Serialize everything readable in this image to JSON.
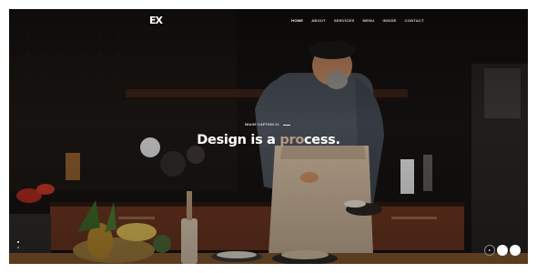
{
  "brand": {
    "logo_text": "EX"
  },
  "nav": {
    "items": [
      "HOME",
      "ABOUT",
      "SERVICES",
      "MENU",
      "INSIDE",
      "CONTACT"
    ],
    "active_index": 0
  },
  "hero": {
    "caption": "IMAGE CAPTION #1",
    "headline_part1": "Design is a ",
    "headline_dim": "pro",
    "headline_part2": "cess."
  },
  "slider": {
    "slide_count": 2,
    "active_slide": 1
  },
  "colors": {
    "background": "#0d0b0a",
    "accent_text": "#c9a98a",
    "text": "#ffffff"
  }
}
